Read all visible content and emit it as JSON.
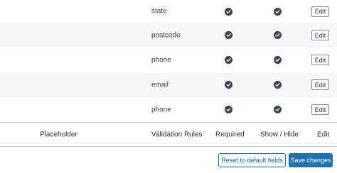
{
  "rows": [
    {
      "name": "state",
      "required": true,
      "visible": true,
      "edit_label": "Edit"
    },
    {
      "name": "postcode",
      "required": true,
      "visible": true,
      "edit_label": "Edit"
    },
    {
      "name": "phone",
      "required": true,
      "visible": true,
      "edit_label": "Edit"
    },
    {
      "name": "email",
      "required": true,
      "visible": true,
      "edit_label": "Edit"
    },
    {
      "name": "phone",
      "required": true,
      "visible": true,
      "edit_label": "Edit"
    }
  ],
  "columns": {
    "placeholder": "Placeholder",
    "validation": "Validation Rules",
    "required": "Required",
    "show_hide": "Show / Hide",
    "edit": "Edit"
  },
  "actions": {
    "reset_label": "Reset to default fields",
    "save_label": "Save changes"
  },
  "colors": {
    "accent": "#2271b1",
    "row_alt": "#f6f7f7",
    "check": "#3c434a"
  },
  "icons": {
    "required": "check-circle-icon",
    "visible": "check-circle-icon"
  }
}
